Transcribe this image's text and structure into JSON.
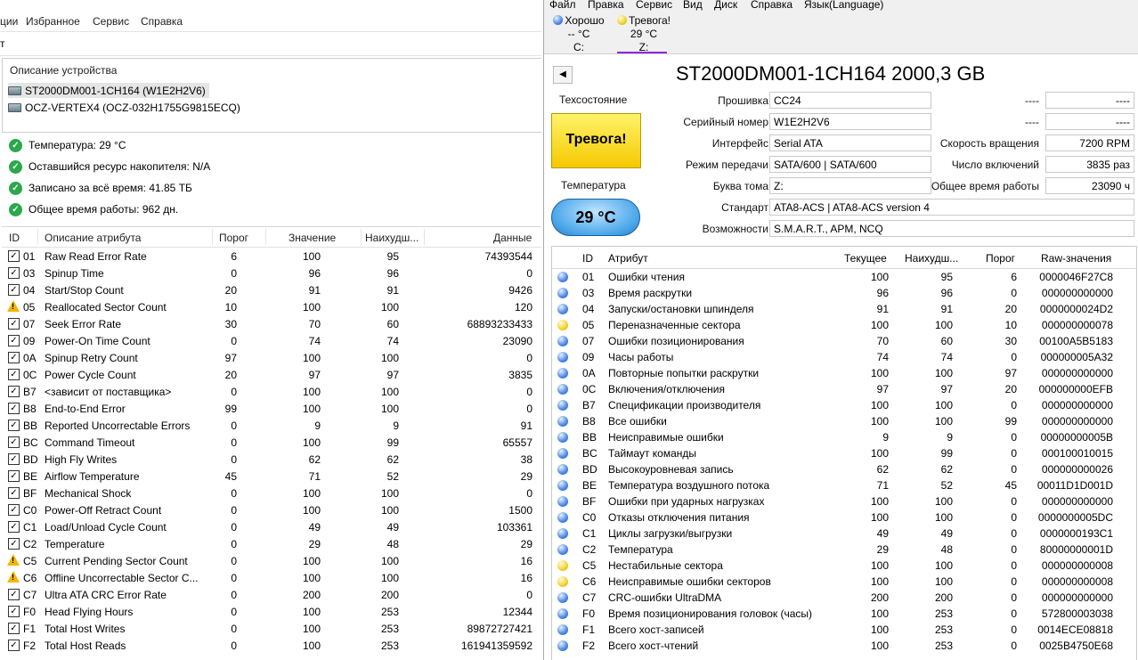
{
  "left": {
    "menu": [
      "ции",
      "Избранное",
      "Сервис",
      "Справка"
    ],
    "toolbar_fragment": "т",
    "device_panel_title": "Описание устройства",
    "devices": [
      {
        "label": "ST2000DM001-1CH164 (W1E2H2V6)",
        "selected": true
      },
      {
        "label": "OCZ-VERTEX4 (OCZ-032H1755G9815ECQ)",
        "selected": false
      }
    ],
    "status": [
      "Температура: 29 °C",
      "Оставшийся ресурс накопителя: N/A",
      "Записано за всё время: 41.85 ТБ",
      "Общее время работы: 962 дн."
    ],
    "columns": [
      "ID",
      "Описание атрибута",
      "Порог",
      "Значение",
      "Наихудш...",
      "Данные"
    ],
    "rows": [
      {
        "icon": "check",
        "id": "01",
        "name": "Raw Read Error Rate",
        "thr": "6",
        "val": "100",
        "worst": "95",
        "data": "74393544"
      },
      {
        "icon": "check",
        "id": "03",
        "name": "Spinup Time",
        "thr": "0",
        "val": "96",
        "worst": "96",
        "data": "0"
      },
      {
        "icon": "check",
        "id": "04",
        "name": "Start/Stop Count",
        "thr": "20",
        "val": "91",
        "worst": "91",
        "data": "9426"
      },
      {
        "icon": "warn",
        "id": "05",
        "name": "Reallocated Sector Count",
        "thr": "10",
        "val": "100",
        "worst": "100",
        "data": "120"
      },
      {
        "icon": "check",
        "id": "07",
        "name": "Seek Error Rate",
        "thr": "30",
        "val": "70",
        "worst": "60",
        "data": "68893233433"
      },
      {
        "icon": "check",
        "id": "09",
        "name": "Power-On Time Count",
        "thr": "0",
        "val": "74",
        "worst": "74",
        "data": "23090"
      },
      {
        "icon": "check",
        "id": "0A",
        "name": "Spinup Retry Count",
        "thr": "97",
        "val": "100",
        "worst": "100",
        "data": "0"
      },
      {
        "icon": "check",
        "id": "0C",
        "name": "Power Cycle Count",
        "thr": "20",
        "val": "97",
        "worst": "97",
        "data": "3835"
      },
      {
        "icon": "check",
        "id": "B7",
        "name": "<зависит от поставщика>",
        "thr": "0",
        "val": "100",
        "worst": "100",
        "data": "0"
      },
      {
        "icon": "check",
        "id": "B8",
        "name": "End-to-End Error",
        "thr": "99",
        "val": "100",
        "worst": "100",
        "data": "0"
      },
      {
        "icon": "check",
        "id": "BB",
        "name": "Reported Uncorrectable Errors",
        "thr": "0",
        "val": "9",
        "worst": "9",
        "data": "91"
      },
      {
        "icon": "check",
        "id": "BC",
        "name": "Command Timeout",
        "thr": "0",
        "val": "100",
        "worst": "99",
        "data": "65557"
      },
      {
        "icon": "check",
        "id": "BD",
        "name": "High Fly Writes",
        "thr": "0",
        "val": "62",
        "worst": "62",
        "data": "38"
      },
      {
        "icon": "check",
        "id": "BE",
        "name": "Airflow Temperature",
        "thr": "45",
        "val": "71",
        "worst": "52",
        "data": "29"
      },
      {
        "icon": "check",
        "id": "BF",
        "name": "Mechanical Shock",
        "thr": "0",
        "val": "100",
        "worst": "100",
        "data": "0"
      },
      {
        "icon": "check",
        "id": "C0",
        "name": "Power-Off Retract Count",
        "thr": "0",
        "val": "100",
        "worst": "100",
        "data": "1500"
      },
      {
        "icon": "check",
        "id": "C1",
        "name": "Load/Unload Cycle Count",
        "thr": "0",
        "val": "49",
        "worst": "49",
        "data": "103361"
      },
      {
        "icon": "check",
        "id": "C2",
        "name": "Temperature",
        "thr": "0",
        "val": "29",
        "worst": "48",
        "data": "29"
      },
      {
        "icon": "warn",
        "id": "C5",
        "name": "Current Pending Sector Count",
        "thr": "0",
        "val": "100",
        "worst": "100",
        "data": "16"
      },
      {
        "icon": "warn",
        "id": "C6",
        "name": "Offline Uncorrectable Sector C...",
        "thr": "0",
        "val": "100",
        "worst": "100",
        "data": "16"
      },
      {
        "icon": "check",
        "id": "C7",
        "name": "Ultra ATA CRC Error Rate",
        "thr": "0",
        "val": "200",
        "worst": "200",
        "data": "0"
      },
      {
        "icon": "check",
        "id": "F0",
        "name": "Head Flying Hours",
        "thr": "0",
        "val": "100",
        "worst": "253",
        "data": "12344"
      },
      {
        "icon": "check",
        "id": "F1",
        "name": "Total Host Writes",
        "thr": "0",
        "val": "100",
        "worst": "253",
        "data": "89872727421"
      },
      {
        "icon": "check",
        "id": "F2",
        "name": "Total Host Reads",
        "thr": "0",
        "val": "100",
        "worst": "253",
        "data": "161941359592"
      }
    ]
  },
  "right": {
    "menu": [
      "Файл",
      "Правка",
      "Сервис",
      "Вид",
      "Диск",
      "Справка",
      "Язык(Language)"
    ],
    "drives": [
      {
        "status": "Хорошо",
        "temp": "-- °C",
        "letter": "C:",
        "dot": "blue"
      },
      {
        "status": "Тревога!",
        "temp": "29 °C",
        "letter": "Z:",
        "dot": "yellow"
      }
    ],
    "back_button": "◀",
    "model_title": "ST2000DM001-1CH164 2000,3 GB",
    "health_label": "Техсостояние",
    "health_value": "Тревога!",
    "temp_label": "Температура",
    "temp_value": "29 °C",
    "fields": {
      "firmware_label": "Прошивка",
      "firmware": "CC24",
      "serial_label": "Серийный номер",
      "serial": "W1E2H2V6",
      "interface_label": "Интерфейс",
      "interface": "Serial ATA",
      "transfer_label": "Режим передачи",
      "transfer": "SATA/600 | SATA/600",
      "volume_label": "Буква тома",
      "volume": "Z:",
      "standard_label": "Стандарт",
      "standard": "ATA8-ACS | ATA8-ACS version 4",
      "features_label": "Возможности",
      "features": "S.M.A.R.T., APM, NCQ",
      "r1_label": "----",
      "r1": "----",
      "r2_label": "----",
      "r2": "----",
      "rpm_label": "Скорость вращения",
      "rpm": "7200 RPM",
      "power_count_label": "Число включений",
      "power_count": "3835 раз",
      "power_hours_label": "Общее время работы",
      "power_hours": "23090 ч"
    },
    "columns": [
      "ID",
      "Атрибут",
      "Текущее",
      "Наихудш...",
      "Порог",
      "Raw-значения"
    ],
    "rows": [
      {
        "dot": "blue",
        "id": "01",
        "name": "Ошибки чтения",
        "cur": "100",
        "worst": "95",
        "thr": "6",
        "raw": "0000046F27C8"
      },
      {
        "dot": "blue",
        "id": "03",
        "name": "Время раскрутки",
        "cur": "96",
        "worst": "96",
        "thr": "0",
        "raw": "000000000000"
      },
      {
        "dot": "blue",
        "id": "04",
        "name": "Запуски/остановки шпинделя",
        "cur": "91",
        "worst": "91",
        "thr": "20",
        "raw": "0000000024D2"
      },
      {
        "dot": "yellow",
        "id": "05",
        "name": "Переназначенные сектора",
        "cur": "100",
        "worst": "100",
        "thr": "10",
        "raw": "000000000078"
      },
      {
        "dot": "blue",
        "id": "07",
        "name": "Ошибки позиционирования",
        "cur": "70",
        "worst": "60",
        "thr": "30",
        "raw": "00100A5B5183"
      },
      {
        "dot": "blue",
        "id": "09",
        "name": "Часы работы",
        "cur": "74",
        "worst": "74",
        "thr": "0",
        "raw": "000000005A32"
      },
      {
        "dot": "blue",
        "id": "0A",
        "name": "Повторные попытки раскрутки",
        "cur": "100",
        "worst": "100",
        "thr": "97",
        "raw": "000000000000"
      },
      {
        "dot": "blue",
        "id": "0C",
        "name": "Включения/отключения",
        "cur": "97",
        "worst": "97",
        "thr": "20",
        "raw": "000000000EFB"
      },
      {
        "dot": "blue",
        "id": "B7",
        "name": "Спецификации производителя",
        "cur": "100",
        "worst": "100",
        "thr": "0",
        "raw": "000000000000"
      },
      {
        "dot": "blue",
        "id": "B8",
        "name": "Все ошибки",
        "cur": "100",
        "worst": "100",
        "thr": "99",
        "raw": "000000000000"
      },
      {
        "dot": "blue",
        "id": "BB",
        "name": "Неисправимые ошибки",
        "cur": "9",
        "worst": "9",
        "thr": "0",
        "raw": "00000000005B"
      },
      {
        "dot": "blue",
        "id": "BC",
        "name": "Таймаут команды",
        "cur": "100",
        "worst": "99",
        "thr": "0",
        "raw": "000100010015"
      },
      {
        "dot": "blue",
        "id": "BD",
        "name": "Высокоуровневая запись",
        "cur": "62",
        "worst": "62",
        "thr": "0",
        "raw": "000000000026"
      },
      {
        "dot": "blue",
        "id": "BE",
        "name": "Температура воздушного потока",
        "cur": "71",
        "worst": "52",
        "thr": "45",
        "raw": "00011D1D001D"
      },
      {
        "dot": "blue",
        "id": "BF",
        "name": "Ошибки при ударных нагрузках",
        "cur": "100",
        "worst": "100",
        "thr": "0",
        "raw": "000000000000"
      },
      {
        "dot": "blue",
        "id": "C0",
        "name": "Отказы отключения питания",
        "cur": "100",
        "worst": "100",
        "thr": "0",
        "raw": "0000000005DC"
      },
      {
        "dot": "blue",
        "id": "C1",
        "name": "Циклы загрузки/выгрузки",
        "cur": "49",
        "worst": "49",
        "thr": "0",
        "raw": "0000000193C1"
      },
      {
        "dot": "blue",
        "id": "C2",
        "name": "Температура",
        "cur": "29",
        "worst": "48",
        "thr": "0",
        "raw": "80000000001D"
      },
      {
        "dot": "yellow",
        "id": "C5",
        "name": "Нестабильные сектора",
        "cur": "100",
        "worst": "100",
        "thr": "0",
        "raw": "000000000008"
      },
      {
        "dot": "yellow",
        "id": "C6",
        "name": "Неисправимые ошибки секторов",
        "cur": "100",
        "worst": "100",
        "thr": "0",
        "raw": "000000000008"
      },
      {
        "dot": "blue",
        "id": "C7",
        "name": "CRC-ошибки UltraDMA",
        "cur": "200",
        "worst": "200",
        "thr": "0",
        "raw": "000000000000"
      },
      {
        "dot": "blue",
        "id": "F0",
        "name": "Время позиционирования головок (часы)",
        "cur": "100",
        "worst": "253",
        "thr": "0",
        "raw": "572800003038"
      },
      {
        "dot": "blue",
        "id": "F1",
        "name": "Всего хост-записей",
        "cur": "100",
        "worst": "253",
        "thr": "0",
        "raw": "0014ECE08818"
      },
      {
        "dot": "blue",
        "id": "F2",
        "name": "Всего хост-чтений",
        "cur": "100",
        "worst": "253",
        "thr": "0",
        "raw": "0025B4750E68"
      }
    ]
  }
}
